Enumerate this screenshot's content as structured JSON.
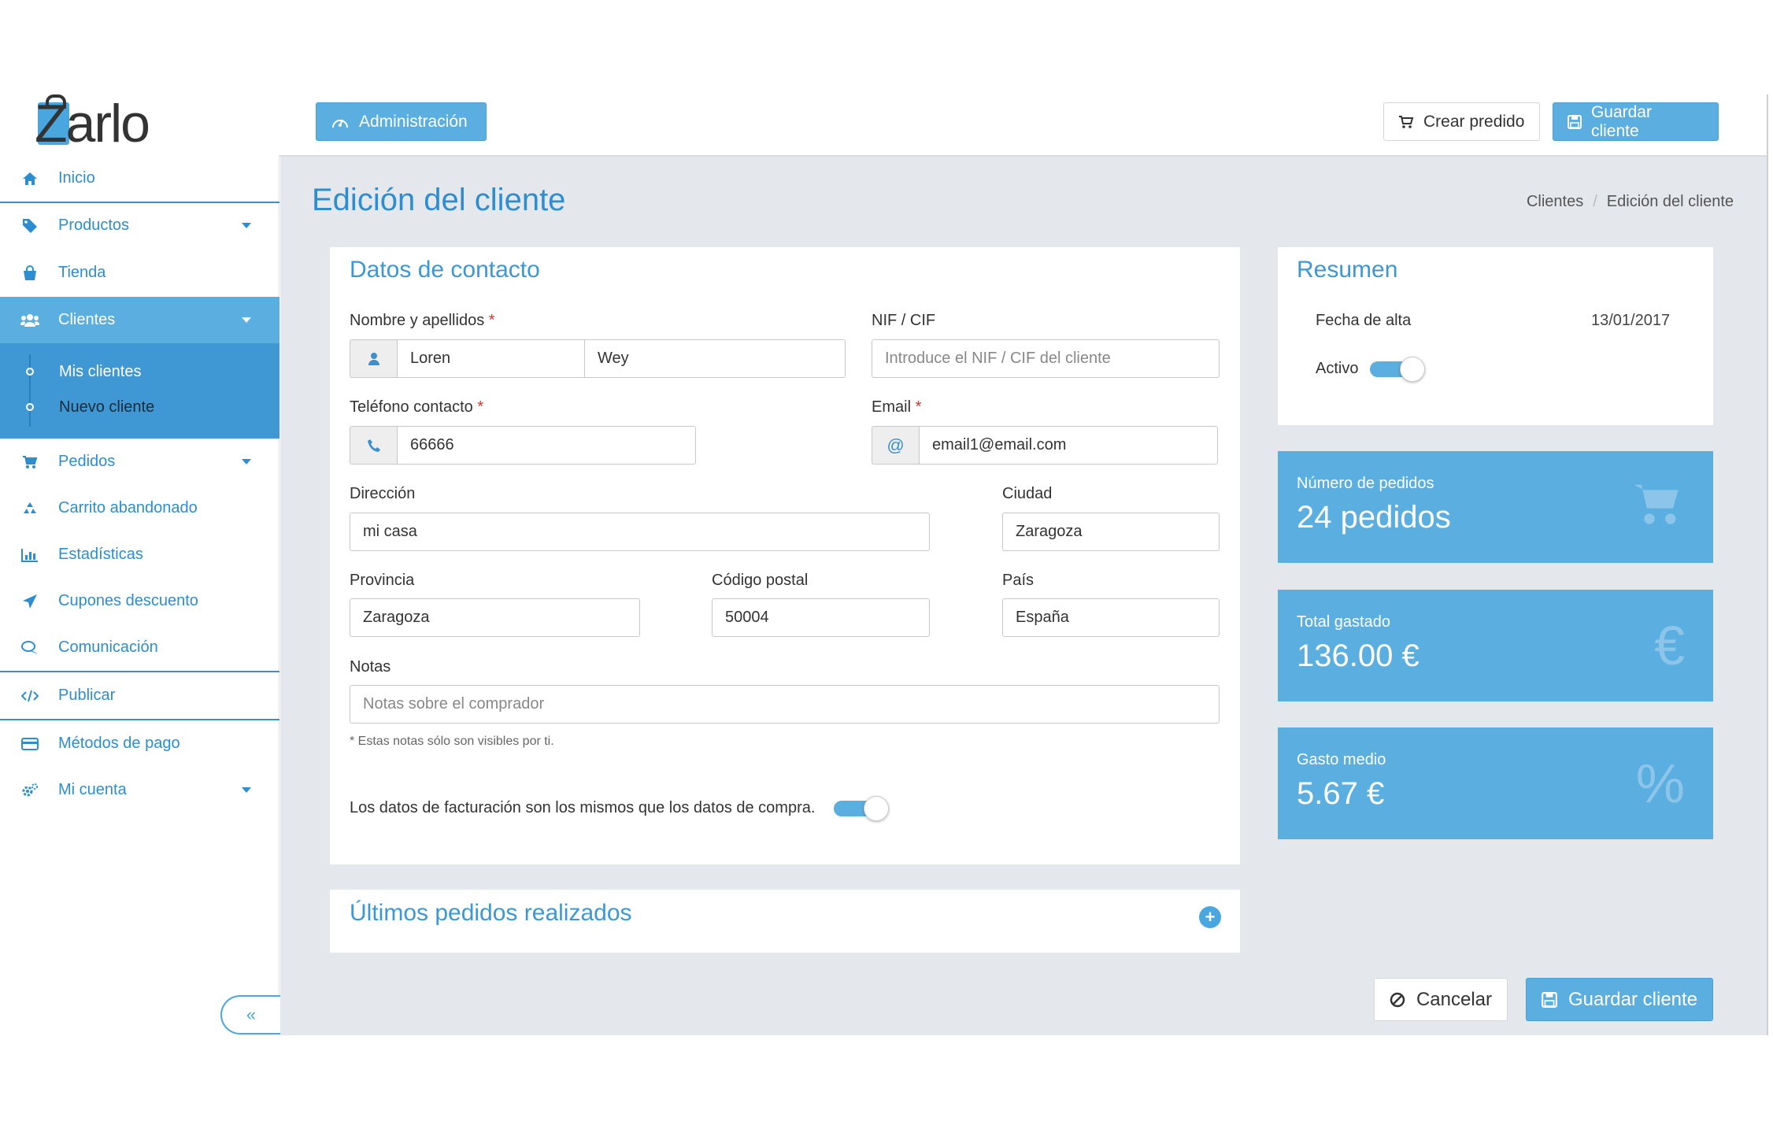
{
  "brand": {
    "logo_text": "Zarlo"
  },
  "header": {
    "admin_label": "Administración",
    "create_order_label": "Crear predido",
    "save_label": "Guardar cliente"
  },
  "sidebar": {
    "items": [
      {
        "label": "Inicio",
        "icon": "home-icon"
      },
      {
        "label": "Productos",
        "icon": "tag-icon"
      },
      {
        "label": "Tienda",
        "icon": "shopping-bag-icon"
      },
      {
        "label": "Clientes",
        "icon": "users-icon"
      },
      {
        "label": "Pedidos",
        "icon": "cart-icon"
      },
      {
        "label": "Carrito abandonado",
        "icon": "recycle-icon"
      },
      {
        "label": "Estadísticas",
        "icon": "bar-chart-icon"
      },
      {
        "label": "Cupones descuento",
        "icon": "paper-plane-icon"
      },
      {
        "label": "Comunicación",
        "icon": "comments-icon"
      },
      {
        "label": "Publicar",
        "icon": "code-icon"
      },
      {
        "label": "Métodos de pago",
        "icon": "credit-card-icon"
      },
      {
        "label": "Mi cuenta",
        "icon": "cogs-icon"
      }
    ],
    "submenu": [
      {
        "label": "Mis clientes"
      },
      {
        "label": "Nuevo cliente"
      }
    ],
    "collapse_label": "«"
  },
  "page": {
    "title": "Edición del cliente",
    "breadcrumb": [
      "Clientes",
      "Edición del cliente"
    ]
  },
  "contact": {
    "title": "Datos de contacto",
    "name_label": "Nombre y apellidos",
    "first_name": "Loren",
    "last_name": "Wey",
    "nif_label": "NIF / CIF",
    "nif_placeholder": "Introduce el NIF / CIF del cliente",
    "phone_label": "Teléfono contacto",
    "phone": "66666",
    "email_label": "Email",
    "email_addon": "@",
    "email": "email1@email.com",
    "address_label": "Dirección",
    "address": "mi casa",
    "city_label": "Ciudad",
    "city": "Zaragoza",
    "province_label": "Provincia",
    "province": "Zaragoza",
    "zip_label": "Código postal",
    "zip": "50004",
    "country_label": "País",
    "country": "España",
    "notes_label": "Notas",
    "notes_placeholder": "Notas sobre el comprador",
    "notes_hint": "* Estas notas sólo son visibles por ti.",
    "billing_same_label": "Los datos de facturación son los mismos que los datos de compra.",
    "billing_same": true,
    "required_mark": "*"
  },
  "orders": {
    "title": "Últimos pedidos realizados",
    "expand_label": "+"
  },
  "summary": {
    "title": "Resumen",
    "created_label": "Fecha de alta",
    "created_value": "13/01/2017",
    "active_label": "Activo",
    "active": true
  },
  "stats": [
    {
      "label": "Número de pedidos",
      "value": "24 pedidos",
      "icon": "cart-icon"
    },
    {
      "label": "Total gastado",
      "value": "136.00 €",
      "icon": "euro-icon",
      "glyph": "€"
    },
    {
      "label": "Gasto medio",
      "value": "5.67 €",
      "icon": "percent-icon",
      "glyph": "%"
    }
  ],
  "footer": {
    "cancel_label": "Cancelar",
    "save_label": "Guardar cliente"
  },
  "colors": {
    "accent": "#5aaee0",
    "link": "#2c8ed0",
    "background": "#e4e8ed",
    "required": "#d9362c"
  }
}
